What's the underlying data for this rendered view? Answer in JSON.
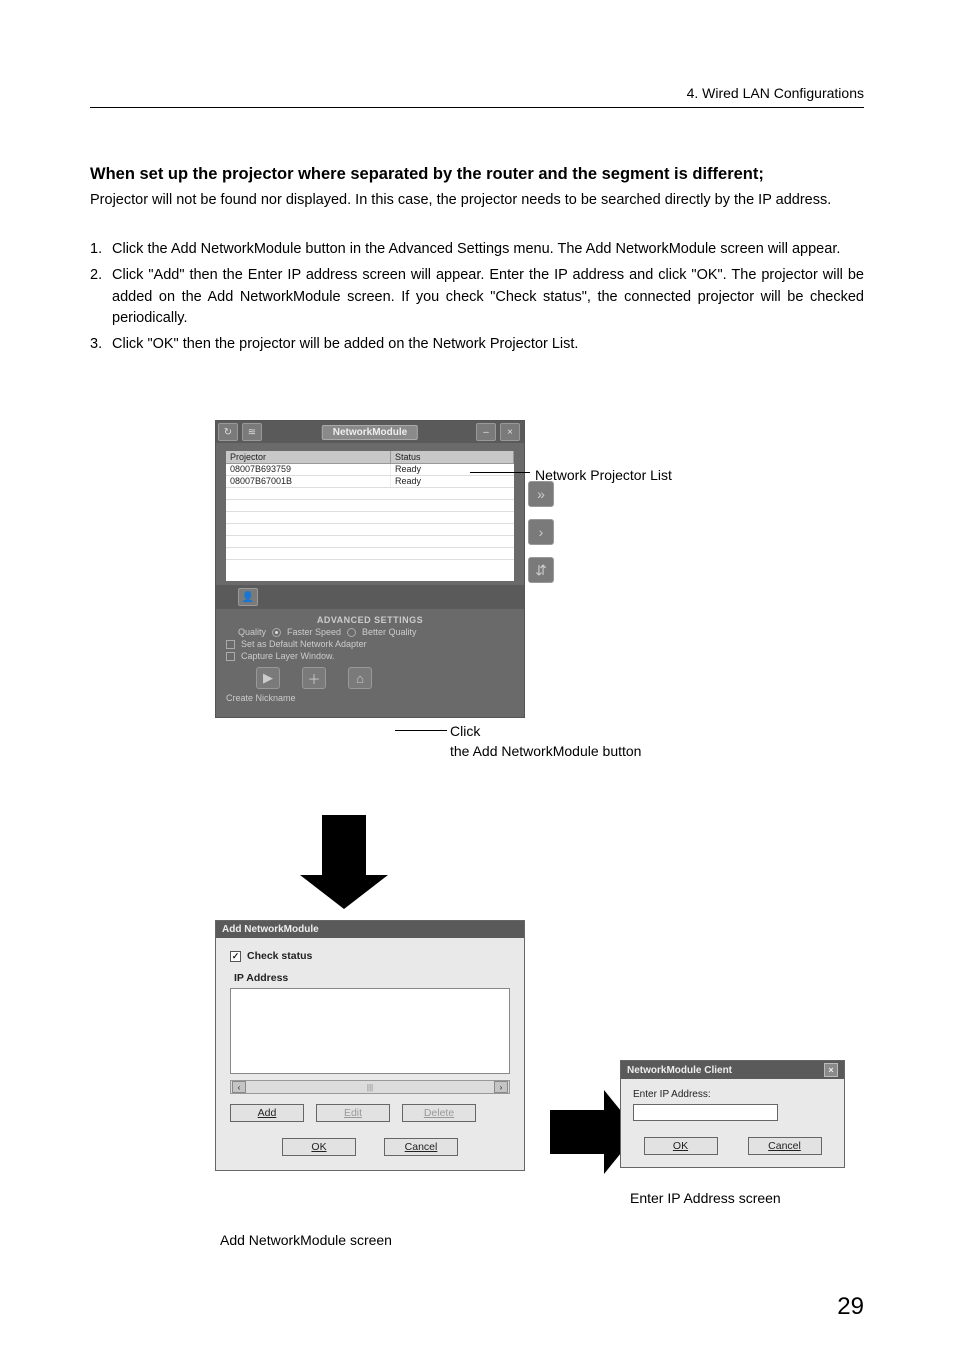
{
  "header": {
    "chapter": "4. Wired LAN Configurations"
  },
  "section": {
    "heading": "When set up the projector where separated by the router and the segment is different;",
    "intro": "Projector will not be found nor displayed. In this case, the projector needs to be searched directly by the IP address.",
    "steps": [
      {
        "n": "1.",
        "t": "Click the Add NetworkModule button in the Advanced Settings menu. The Add NetworkModule screen will appear."
      },
      {
        "n": "2.",
        "t": "Click \"Add\" then the Enter IP address screen will appear.  Enter the IP address and click \"OK\". The projector will be added on the Add NetworkModule screen. If you check \"Check status\", the connected projector will be checked periodically."
      },
      {
        "n": "3.",
        "t": "Click \"OK\" then the projector will be added on the Network Projector List."
      }
    ]
  },
  "nm_window": {
    "title": "NetworkModule",
    "cols": {
      "projector": "Projector",
      "status": "Status"
    },
    "rows": [
      {
        "p": "08007B693759",
        "s": "Ready"
      },
      {
        "p": "08007B67001B",
        "s": "Ready"
      }
    ],
    "advanced": {
      "title": "ADVANCED SETTINGS",
      "quality_label": "Quality",
      "faster": "Faster Speed",
      "better": "Better Quality",
      "set_default": "Set as Default Network Adapter",
      "capture": "Capture Layer Window.",
      "create_nickname": "Create Nickname"
    }
  },
  "callouts": {
    "projector_list": "Network Projector List",
    "click_line1": "Click",
    "click_line2": "the Add NetworkModule button"
  },
  "add_nm": {
    "title": "Add NetworkModule",
    "check_status": "Check status",
    "ip_address": "IP Address",
    "add": "Add",
    "edit": "Edit",
    "delete": "Delete",
    "ok": "OK",
    "cancel": "Cancel",
    "caption": "Add NetworkModule screen"
  },
  "ip_dialog": {
    "title": "NetworkModule Client",
    "label": "Enter IP Address:",
    "ok": "OK",
    "cancel": "Cancel",
    "caption": "Enter IP Address screen"
  },
  "page": {
    "number": "29"
  },
  "icons": {
    "refresh": "↻",
    "wifi": "≋",
    "min": "–",
    "close": "×",
    "push": "»",
    "single": "›",
    "sliders": "⇵",
    "person": "👤",
    "play": "▶",
    "plus": "＋",
    "tool": "⌂",
    "left": "‹",
    "right": "›",
    "check": "✓"
  }
}
